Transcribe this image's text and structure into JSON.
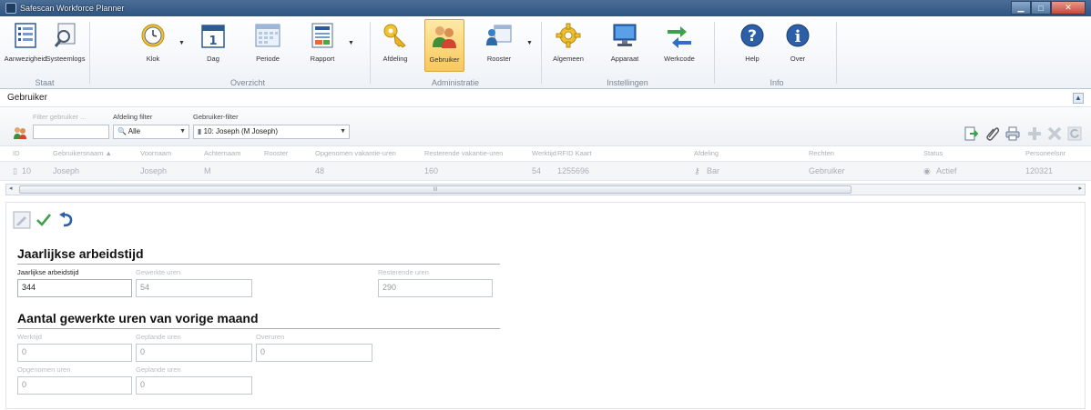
{
  "window": {
    "title": "Safescan Workforce Planner"
  },
  "ribbon": {
    "groups": [
      {
        "label": "Staat",
        "items": [
          {
            "label": "Aanwezigheid"
          },
          {
            "label": "Systeemlogs"
          }
        ]
      },
      {
        "label": "Overzicht",
        "items": [
          {
            "label": "Klok"
          },
          {
            "label": "Dag"
          },
          {
            "label": "Periode"
          },
          {
            "label": "Rapport"
          }
        ]
      },
      {
        "label": "Administratie",
        "items": [
          {
            "label": "Afdeling"
          },
          {
            "label": "Gebruiker"
          },
          {
            "label": "Rooster"
          }
        ]
      },
      {
        "label": "Instellingen",
        "items": [
          {
            "label": "Algemeen"
          },
          {
            "label": "Apparaat"
          },
          {
            "label": "Werkcode"
          }
        ]
      },
      {
        "label": "Info",
        "items": [
          {
            "label": "Help"
          },
          {
            "label": "Over"
          }
        ]
      }
    ],
    "selected": "Gebruiker"
  },
  "section": {
    "title": "Gebruiker",
    "filters": {
      "search_label": "Filter gebruiker ...",
      "search_value": "",
      "dept_label": "Afdeling filter",
      "dept_value": "Alle",
      "user_label": "Gebruiker-filter",
      "user_value": "10: Joseph (M Joseph)"
    }
  },
  "grid": {
    "columns": [
      "ID",
      "Gebruikersnaam",
      "Voornaam",
      "Achternaam",
      "Rooster",
      "Opgenomen vakantie-uren",
      "Resterende vakantie-uren",
      "Werktijd",
      "RFID Kaart",
      "Afdeling",
      "Rechten",
      "Status",
      "Personeelsnr"
    ],
    "sort_indicator": "▲",
    "row": {
      "id": "10",
      "username": "Joseph",
      "firstname": "Joseph",
      "lastname": "M",
      "roster": "",
      "vac_taken": "48",
      "vac_remaining": "160",
      "worktime": "54",
      "rfid": "1255696",
      "dept": "Bar",
      "rights": "Gebruiker",
      "status": "Actief",
      "personnel": "120321"
    },
    "scroll_grip": "III"
  },
  "detail": {
    "annual": {
      "heading": "Jaarlijkse arbeidstijd",
      "fields": [
        {
          "label": "Jaarlijkse arbeidstijd",
          "value": "344"
        },
        {
          "label": "Gewerkte uren",
          "value": "54"
        },
        {
          "label": "Resterende uren",
          "value": "290"
        }
      ]
    },
    "monthly": {
      "heading": "Aantal gewerkte uren van vorige maand",
      "fields": [
        {
          "label": "Werktijd",
          "value": "0"
        },
        {
          "label": "Geplande uren",
          "value": "0"
        },
        {
          "label": "Overuren",
          "value": "0"
        },
        {
          "label": "Opgenomen uren",
          "value": "0"
        },
        {
          "label": "Geplande uren",
          "value": "0"
        }
      ]
    }
  }
}
